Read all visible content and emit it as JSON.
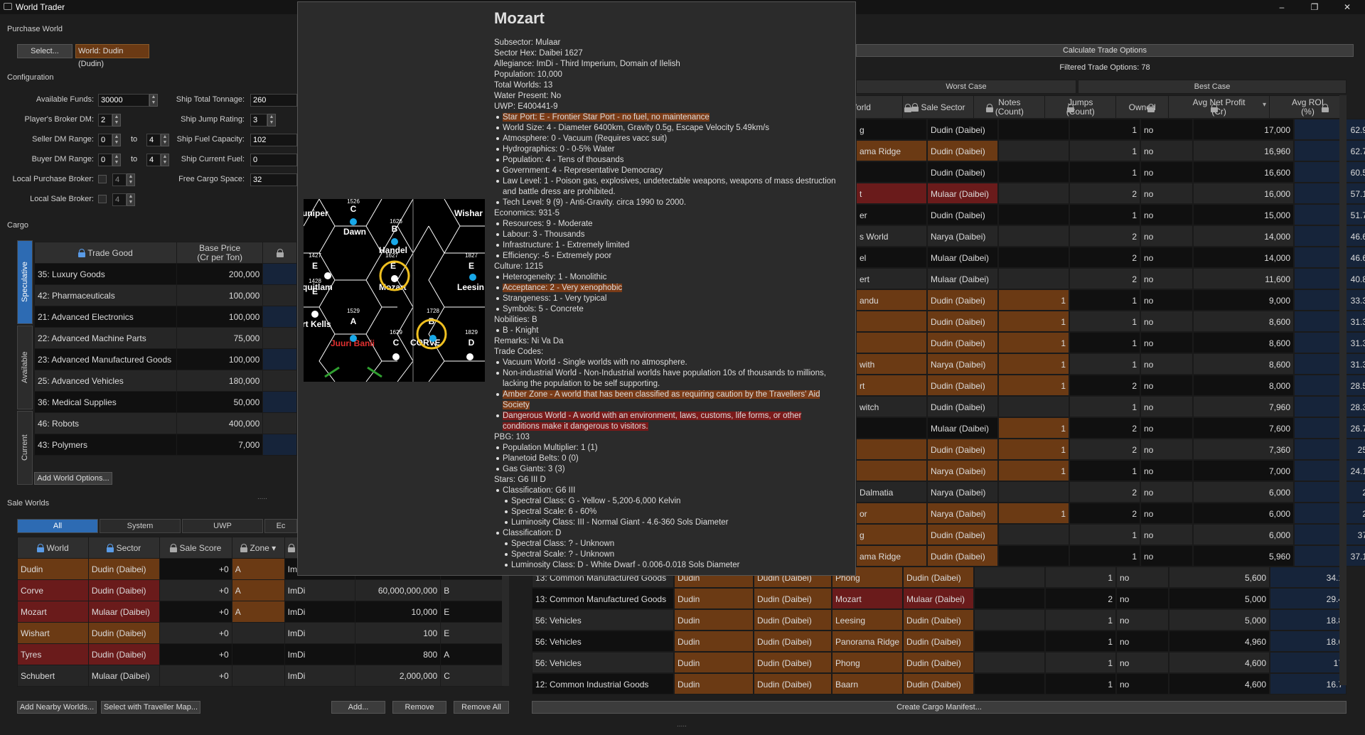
{
  "app": {
    "title": "World Trader"
  },
  "purchase": {
    "section": "Purchase World",
    "select": "Select...",
    "world": "World: Dudin (Dudin)"
  },
  "config": {
    "section": "Configuration",
    "available_funds_label": "Available Funds:",
    "available_funds": "30000",
    "broker_dm_label": "Player's Broker DM:",
    "broker_dm": "2",
    "seller_dm_label": "Seller DM Range:",
    "seller_min": "0",
    "seller_max": "4",
    "buyer_dm_label": "Buyer DM Range:",
    "buyer_min": "0",
    "buyer_max": "4",
    "local_purchase_label": "Local Purchase Broker:",
    "local_purchase": "4",
    "local_sale_label": "Local Sale Broker:",
    "local_sale": "4",
    "to": "to",
    "tonnage_label": "Ship Total Tonnage:",
    "tonnage": "260",
    "jump_label": "Ship Jump Rating:",
    "jump": "3",
    "fuel_cap_label": "Ship Fuel Capacity:",
    "fuel_cap": "102",
    "fuel_cur_label": "Ship Current Fuel:",
    "fuel_cur": "0",
    "cargo_space_label": "Free Cargo Space:",
    "cargo_space": "32"
  },
  "cargo": {
    "section": "Cargo",
    "tabs": [
      "Speculative",
      "Available",
      "Current"
    ],
    "headers": [
      "Trade Good",
      "Base Price\n(Cr per Ton)"
    ],
    "rows": [
      [
        "35: Luxury Goods",
        "200,000"
      ],
      [
        "42: Pharmaceuticals",
        "100,000"
      ],
      [
        "21: Advanced Electronics",
        "100,000"
      ],
      [
        "22: Advanced Machine Parts",
        "75,000"
      ],
      [
        "23: Advanced Manufactured Goods",
        "100,000"
      ],
      [
        "25: Advanced Vehicles",
        "180,000"
      ],
      [
        "36: Medical Supplies",
        "50,000"
      ],
      [
        "46: Robots",
        "400,000"
      ],
      [
        "43: Polymers",
        "7,000"
      ]
    ],
    "add_world_options": "Add World Options..."
  },
  "sale": {
    "section": "Sale Worlds",
    "tabs": [
      "All",
      "System",
      "UWP",
      "Ec"
    ],
    "headers": [
      "World",
      "Sector",
      "Sale Score",
      "Zone",
      "Im"
    ],
    "rows": [
      [
        "Dudin",
        "Dudin (Daibei)",
        "+0",
        "A",
        "Im",
        "",
        ""
      ],
      [
        "Corve",
        "Dudin (Daibei)",
        "+0",
        "A",
        "ImDi",
        "60,000,000,000",
        "B"
      ],
      [
        "Mozart",
        "Mulaar (Daibei)",
        "+0",
        "A",
        "ImDi",
        "10,000",
        "E"
      ],
      [
        "Wishart",
        "Dudin (Daibei)",
        "+0",
        "",
        "ImDi",
        "100",
        "E"
      ],
      [
        "Tyres",
        "Dudin (Daibei)",
        "+0",
        "",
        "ImDi",
        "800",
        "A"
      ],
      [
        "Schubert",
        "Mulaar (Daibei)",
        "+0",
        "",
        "ImDi",
        "2,000,000",
        "C"
      ]
    ],
    "add_nearby": "Add Nearby Worlds...",
    "select_map": "Select with Traveller Map...",
    "add": "Add...",
    "remove": "Remove",
    "remove_all": "Remove All"
  },
  "trade": {
    "calculate": "Calculate Trade Options",
    "filtered": "Filtered Trade Options: 78",
    "worst": "Worst Case",
    "best": "Best Case",
    "headers": [
      "ale World",
      "Sale Sector",
      "Notes\n(Count)",
      "Jumps\n(Count)",
      "Owned",
      "Avg Net Profit\n(Cr)",
      "Avg ROI\n(%)"
    ],
    "rows": [
      [
        "g",
        "Dudin (Daibei)",
        "",
        "1",
        "no",
        "17,000",
        "62.9"
      ],
      [
        "ama Ridge",
        "Dudin (Daibei)",
        "",
        "1",
        "no",
        "16,960",
        "62.7"
      ],
      [
        "",
        "Dudin (Daibei)",
        "",
        "1",
        "no",
        "16,600",
        "60.5"
      ],
      [
        "t",
        "Mulaar (Daibei)",
        "",
        "2",
        "no",
        "16,000",
        "57.1"
      ],
      [
        "er",
        "Dudin (Daibei)",
        "",
        "1",
        "no",
        "15,000",
        "51.7"
      ],
      [
        "s World",
        "Narya (Daibei)",
        "",
        "2",
        "no",
        "14,000",
        "46.6"
      ],
      [
        "el",
        "Mulaar (Daibei)",
        "",
        "2",
        "no",
        "14,000",
        "46.6"
      ],
      [
        "ert",
        "Mulaar (Daibei)",
        "",
        "2",
        "no",
        "11,600",
        "40.8"
      ],
      [
        "andu",
        "Dudin (Daibei)",
        "1",
        "1",
        "no",
        "9,000",
        "33.3"
      ],
      [
        "",
        "Dudin (Daibei)",
        "1",
        "1",
        "no",
        "8,600",
        "31.3"
      ],
      [
        "",
        "Dudin (Daibei)",
        "1",
        "1",
        "no",
        "8,600",
        "31.3"
      ],
      [
        "with",
        "Narya (Daibei)",
        "1",
        "1",
        "no",
        "8,600",
        "31.3"
      ],
      [
        "rt",
        "Dudin (Daibei)",
        "1",
        "2",
        "no",
        "8,000",
        "28.5"
      ],
      [
        "witch",
        "Dudin (Daibei)",
        "",
        "1",
        "no",
        "7,960",
        "28.3"
      ],
      [
        "",
        "Mulaar (Daibei)",
        "1",
        "2",
        "no",
        "7,600",
        "26.7"
      ],
      [
        "",
        "Dudin (Daibei)",
        "1",
        "2",
        "no",
        "7,360",
        "25"
      ],
      [
        "",
        "Narya (Daibei)",
        "1",
        "1",
        "no",
        "7,000",
        "24.1"
      ],
      [
        "Dalmatia",
        "Narya (Daibei)",
        "",
        "2",
        "no",
        "6,000",
        "2"
      ],
      [
        "or",
        "Narya (Daibei)",
        "1",
        "2",
        "no",
        "6,000",
        "2"
      ],
      [
        "g",
        "Dudin (Daibei)",
        "",
        "1",
        "no",
        "6,000",
        "37"
      ],
      [
        "ama Ridge",
        "Dudin (Daibei)",
        "",
        "1",
        "no",
        "5,960",
        "37.1"
      ]
    ],
    "full_rows": [
      [
        "13: Common Manufactured Goods",
        "Dudin",
        "Dudin (Daibei)",
        "Phong",
        "Dudin (Daibei)",
        "",
        "1",
        "no",
        "5,600",
        "34.1"
      ],
      [
        "13: Common Manufactured Goods",
        "Dudin",
        "Dudin (Daibei)",
        "Mozart",
        "Mulaar (Daibei)",
        "",
        "2",
        "no",
        "5,000",
        "29.4"
      ],
      [
        "56: Vehicles",
        "Dudin",
        "Dudin (Daibei)",
        "Leesing",
        "Dudin (Daibei)",
        "",
        "1",
        "no",
        "5,000",
        "18.8"
      ],
      [
        "56: Vehicles",
        "Dudin",
        "Dudin (Daibei)",
        "Panorama Ridge",
        "Dudin (Daibei)",
        "",
        "1",
        "no",
        "4,960",
        "18.6"
      ],
      [
        "56: Vehicles",
        "Dudin",
        "Dudin (Daibei)",
        "Phong",
        "Dudin (Daibei)",
        "",
        "1",
        "no",
        "4,600",
        "17"
      ],
      [
        "12: Common Industrial Goods",
        "Dudin",
        "Dudin (Daibei)",
        "Baarn",
        "Dudin (Daibei)",
        "",
        "1",
        "no",
        "4,600",
        "16.7"
      ]
    ],
    "create_manifest": "Create Cargo Manifest..."
  },
  "map": {
    "hexes": [
      "1526",
      "1626",
      "1427",
      "1827",
      "1428",
      "1529",
      "1728",
      "1629",
      "1829",
      "1627"
    ],
    "names": [
      "uniper",
      "Dawn",
      "Wishar",
      "Handel",
      "quitlam",
      "Mozart",
      "Leesin",
      "rt Kells",
      "Juuri Banii",
      "CORVE"
    ],
    "uwp": [
      "C",
      "B",
      "E",
      "E",
      "E",
      "A",
      "B",
      "C",
      "D",
      "E"
    ]
  },
  "popup": {
    "title": "Mozart",
    "lines": [
      {
        "t": "Subsector: Mulaar",
        "l": 0
      },
      {
        "t": "Sector Hex: Daibei 1627",
        "l": 0
      },
      {
        "t": "Allegiance: ImDi - Third Imperium, Domain of Ilelish",
        "l": 0
      },
      {
        "t": "Population: 10,000",
        "l": 0
      },
      {
        "t": "Total Worlds: 13",
        "l": 0
      },
      {
        "t": "Water Present: No",
        "l": 0
      },
      {
        "t": "UWP: E400441-9",
        "l": 0
      },
      {
        "t": "Star Port: E - Frontier Star Port - no fuel, no maintenance",
        "l": 1,
        "h": "o"
      },
      {
        "t": "World Size: 4 - Diameter 6400km, Gravity 0.5g, Escape Velocity 5.49km/s",
        "l": 1
      },
      {
        "t": "Atmosphere: 0 - Vacuum (Requires vacc suit)",
        "l": 1
      },
      {
        "t": "Hydrographics: 0 - 0-5% Water",
        "l": 1
      },
      {
        "t": "Population: 4 - Tens of thousands",
        "l": 1
      },
      {
        "t": "Government: 4 - Representative Democracy",
        "l": 1
      },
      {
        "t": "Law Level: 1 - Poison gas, explosives, undetectable weapons, weapons of mass destruction",
        "l": 1
      },
      {
        "t": "and battle dress are prohibited.",
        "l": 1,
        "c": true
      },
      {
        "t": "Tech Level: 9 (9) - Anti-Gravity. circa 1990 to 2000.",
        "l": 1
      },
      {
        "t": "Economics: 931-5",
        "l": 0
      },
      {
        "t": "Resources: 9 - Moderate",
        "l": 1
      },
      {
        "t": "Labour: 3 - Thousands",
        "l": 1
      },
      {
        "t": "Infrastructure: 1 - Extremely limited",
        "l": 1
      },
      {
        "t": "Efficiency: -5 - Extremely poor",
        "l": 1
      },
      {
        "t": "Culture: 1215",
        "l": 0
      },
      {
        "t": "Heterogeneity: 1 - Monolithic",
        "l": 1
      },
      {
        "t": "Acceptance: 2 - Very xenophobic",
        "l": 1,
        "h": "o"
      },
      {
        "t": "Strangeness: 1 - Very typical",
        "l": 1
      },
      {
        "t": "Symbols: 5 - Concrete",
        "l": 1
      },
      {
        "t": "Nobilities: B",
        "l": 0
      },
      {
        "t": "B - Knight",
        "l": 1
      },
      {
        "t": "Remarks: Ni Va Da",
        "l": 0
      },
      {
        "t": "Trade Codes:",
        "l": 0
      },
      {
        "t": "Vacuum World - Single worlds with no atmosphere.",
        "l": 1
      },
      {
        "t": "Non-industrial World - Non-Industrial worlds have population 10s of thousands to millions,",
        "l": 1
      },
      {
        "t": "lacking the population to be self supporting.",
        "l": 1,
        "c": true
      },
      {
        "t": "Amber Zone - A world that has been classified as requiring caution by the Travellers' Aid",
        "l": 1,
        "h": "o"
      },
      {
        "t": "Society",
        "l": 1,
        "c": true,
        "h": "o"
      },
      {
        "t": "Dangerous World - A world with an environment, laws, customs, life forms, or other",
        "l": 1,
        "h": "r"
      },
      {
        "t": "conditions make it dangerous to visitors.",
        "l": 1,
        "c": true,
        "h": "r"
      },
      {
        "t": "PBG: 103",
        "l": 0
      },
      {
        "t": "Population Multiplier: 1 (1)",
        "l": 1
      },
      {
        "t": "Planetoid Belts: 0 (0)",
        "l": 1
      },
      {
        "t": "Gas Giants: 3 (3)",
        "l": 1
      },
      {
        "t": "Stars: G6 III D",
        "l": 0
      },
      {
        "t": "Classification: G6 III",
        "l": 1
      },
      {
        "t": "Spectral Class: G - Yellow - 5,200-6,000 Kelvin",
        "l": 2
      },
      {
        "t": "Spectral Scale: 6 - 60%",
        "l": 2
      },
      {
        "t": "Luminosity Class: III - Normal Giant - 4.6-360 Sols Diameter",
        "l": 2
      },
      {
        "t": "Classification: D",
        "l": 1
      },
      {
        "t": "Spectral Class: ? - Unknown",
        "l": 2
      },
      {
        "t": "Spectral Scale: ? - Unknown",
        "l": 2
      },
      {
        "t": "Luminosity Class: D - White Dwarf - 0.006-0.018 Sols Diameter",
        "l": 2
      }
    ]
  },
  "colors": {
    "accent": "#2d6bb3",
    "brown": "#6b3a14",
    "red": "#6a1b1b",
    "amber_highlight": "#7a3b17",
    "red_highlight": "#7a1a1a"
  }
}
